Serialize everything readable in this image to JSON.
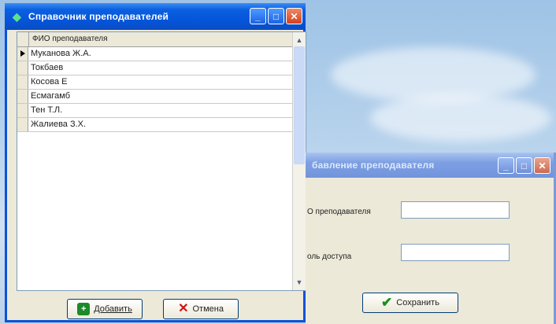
{
  "teachers_window": {
    "title": "Справочник преподавателей",
    "column_header": "ФИО преподавателя",
    "rows": [
      "Муканова Ж.А.",
      "Токбаев",
      "Косова Е",
      "Есмагамб",
      "Тен Т.Л.",
      "Жалиева З.Х."
    ],
    "current_row_index": 0,
    "add_button": "Добавить",
    "cancel_button": "Отмена"
  },
  "add_window": {
    "title": "бавление преподавателя",
    "name_label": "О преподавателя",
    "name_value": "",
    "password_label": "оль доступа",
    "password_value": "",
    "save_button": "Сохранить"
  },
  "icons": {
    "title_icon": "diamond-icon",
    "minimize": "minimize-icon",
    "maximize": "maximize-icon",
    "close": "close-icon",
    "add": "add-icon",
    "cancel": "cancel-x-icon",
    "save": "checkmark-icon"
  },
  "colors": {
    "titlebar_active": "#0454d8",
    "titlebar_inactive": "#7d9fe2",
    "window_face": "#ece9d8",
    "close_button": "#d5401a"
  }
}
